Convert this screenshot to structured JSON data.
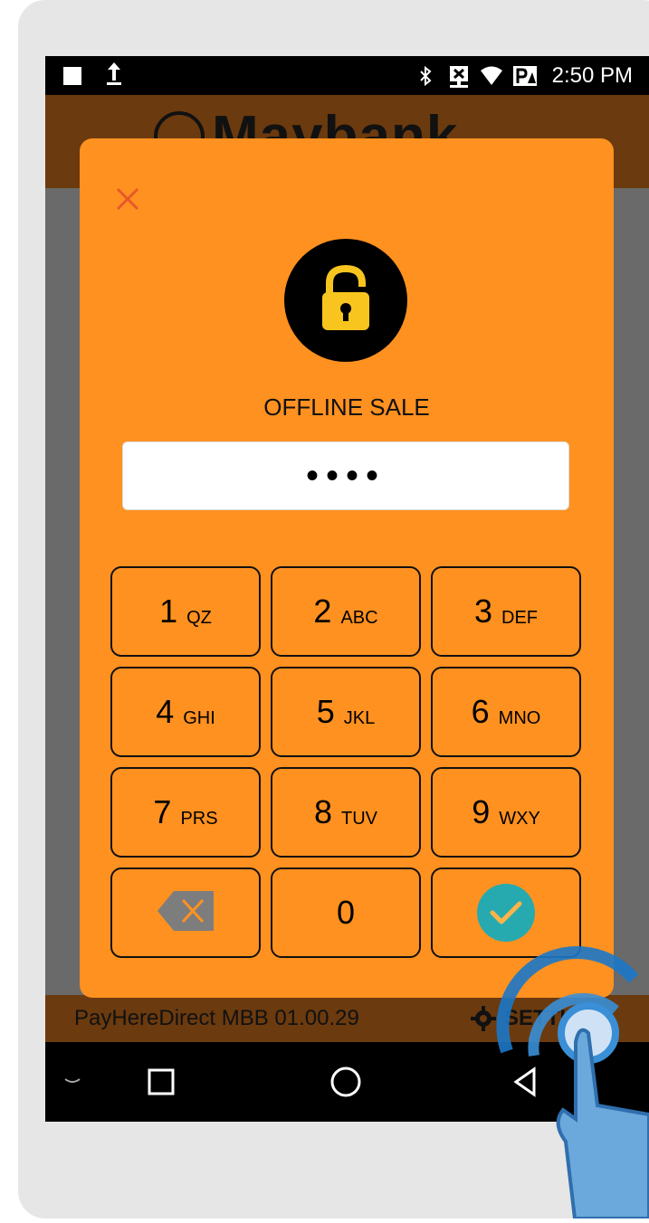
{
  "status_bar": {
    "time": "2:50 PM",
    "left_icons": [
      "square-icon",
      "upload-icon"
    ],
    "right_icons": [
      "bluetooth-icon",
      "network-x-icon",
      "wifi-icon",
      "notification-icon"
    ]
  },
  "app_header": {
    "logo_text": "Maybank",
    "logo_icon": "tiger-emblem-icon"
  },
  "dialog": {
    "close_icon": "close-icon",
    "lock_icon": "lock-icon",
    "title": "OFFLINE SALE",
    "pin_value": "••••",
    "keys": [
      {
        "num": "1",
        "letters": "QZ"
      },
      {
        "num": "2",
        "letters": "ABC"
      },
      {
        "num": "3",
        "letters": "DEF"
      },
      {
        "num": "4",
        "letters": "GHI"
      },
      {
        "num": "5",
        "letters": "JKL"
      },
      {
        "num": "6",
        "letters": "MNO"
      },
      {
        "num": "7",
        "letters": "PRS"
      },
      {
        "num": "8",
        "letters": "TUV"
      },
      {
        "num": "9",
        "letters": "WXY"
      },
      {
        "num": "",
        "icon": "backspace-icon"
      },
      {
        "num": "0",
        "letters": ""
      },
      {
        "num": "",
        "icon": "check-icon"
      }
    ]
  },
  "footer": {
    "version": "PayHereDirect MBB 01.00.29",
    "settings_label": "SETTINGS",
    "settings_icon": "gear-icon"
  },
  "nav_bar": {
    "icons": [
      "keyboard-hide-icon",
      "recents-icon",
      "home-icon",
      "back-icon"
    ]
  },
  "colors": {
    "dialog_bg": "#ff9120",
    "header_bg": "#6b3a0e",
    "confirm": "#26aab0",
    "close": "#e8582a",
    "lock": "#f7c51e"
  },
  "overlay": {
    "tap_icon": "tap-hand-icon"
  }
}
